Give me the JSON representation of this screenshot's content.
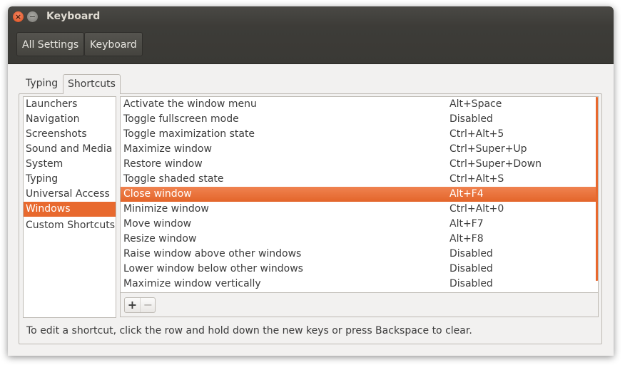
{
  "window": {
    "title": "Keyboard",
    "close_glyph": "×",
    "minimize_glyph": "−"
  },
  "toolbar": {
    "breadcrumbs": [
      "All Settings",
      "Keyboard"
    ]
  },
  "tabs": [
    "Typing",
    "Shortcuts"
  ],
  "active_tab": "Shortcuts",
  "categories": [
    "Launchers",
    "Navigation",
    "Screenshots",
    "Sound and Media",
    "System",
    "Typing",
    "Universal Access",
    "Windows",
    "Custom Shortcuts"
  ],
  "selected_category": "Windows",
  "shortcuts": [
    {
      "name": "Activate the window menu",
      "accel": "Alt+Space"
    },
    {
      "name": "Toggle fullscreen mode",
      "accel": "Disabled"
    },
    {
      "name": "Toggle maximization state",
      "accel": "Ctrl+Alt+5"
    },
    {
      "name": "Maximize window",
      "accel": "Ctrl+Super+Up"
    },
    {
      "name": "Restore window",
      "accel": "Ctrl+Super+Down"
    },
    {
      "name": "Toggle shaded state",
      "accel": "Ctrl+Alt+S"
    },
    {
      "name": "Close window",
      "accel": "Alt+F4"
    },
    {
      "name": "Minimize window",
      "accel": "Ctrl+Alt+0"
    },
    {
      "name": "Move window",
      "accel": "Alt+F7"
    },
    {
      "name": "Resize window",
      "accel": "Alt+F8"
    },
    {
      "name": "Raise window above other windows",
      "accel": "Disabled"
    },
    {
      "name": "Lower window below other windows",
      "accel": "Disabled"
    },
    {
      "name": "Maximize window vertically",
      "accel": "Disabled"
    }
  ],
  "selected_shortcut": "Close window",
  "buttons": {
    "add": "+",
    "remove": "−"
  },
  "hint": "To edit a shortcut, click the row and hold down the new keys or press Backspace to clear.",
  "colors": {
    "accent": "#e8692e",
    "titlebar": "#3d3c38"
  }
}
